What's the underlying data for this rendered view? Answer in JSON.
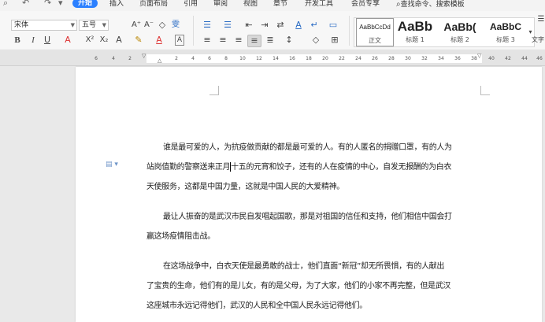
{
  "menubar": {
    "quick_access": [
      "⌕",
      "↶",
      "↷",
      "▾"
    ],
    "tabs": [
      "开始",
      "插入",
      "页面布局",
      "引用",
      "审阅",
      "视图",
      "章节",
      "开发工具",
      "会员专享"
    ],
    "active_tab": "开始",
    "search_label": "查找命令、搜索模板"
  },
  "ribbon": {
    "font_name": "宋体",
    "font_size": "五号",
    "font_buttons": [
      "A⁺",
      "A⁻",
      "◇",
      "雯"
    ],
    "format_buttons": [
      "B",
      "I",
      "U",
      "A",
      "X²",
      "X₂",
      "A",
      "✎",
      "A",
      "A"
    ],
    "para_buttons_row1": [
      "☰",
      "☰",
      "⇤",
      "⇥",
      "⇄",
      "A",
      "↵",
      "▭"
    ],
    "para_buttons_row2": [
      "≡",
      "≡",
      "≡",
      "≡",
      "≣",
      "↕",
      "◇",
      "⊞"
    ],
    "styles": [
      {
        "preview": "AaBbCcDd",
        "name": "正文"
      },
      {
        "preview": "AaBb",
        "name": "标题 1"
      },
      {
        "preview": "AaBb(",
        "name": "标题 2"
      },
      {
        "preview": "AaBbC",
        "name": "标题 3"
      }
    ],
    "text_tool_label": "文字"
  },
  "ruler": {
    "ticks": [
      "6",
      "4",
      "2",
      "",
      "2",
      "4",
      "6",
      "8",
      "10",
      "12",
      "14",
      "16",
      "18",
      "20",
      "22",
      "24",
      "26",
      "28",
      "30",
      "32",
      "34",
      "36",
      "38",
      "40",
      "42",
      "44",
      "46"
    ]
  },
  "document": {
    "para1_lines": [
      "谁是最可爱的人，为抗疫做贡献的都是最可爱的人。有的人匿名的捐赠口罩，有的人为",
      "站岗值勤的警察送来正月",
      "十五的元宵和饺子，还有的人在疫情的中心，自发无报酬的为白衣",
      "天使服务，这都是中国力量，这就是中国人民的大爱精神。"
    ],
    "para2_lines": [
      "最让人振奋的是武汉市民自发唱起国歌，那是对祖国的信任和支持，他们相信中国会打",
      "赢这场疫情阻击战。"
    ],
    "para3_lines": [
      "在这场战争中，白衣天使是最勇敢的战士，他们直面“新冠”却无所畏惧，有的人献出",
      "了宝贵的生命，他们有的是儿女，有的是父母，为了大家，他们的小家不再完整，但是武汉",
      "这座城市永远记得他们，武汉的人民和全中国人民永远记得他们。"
    ]
  }
}
